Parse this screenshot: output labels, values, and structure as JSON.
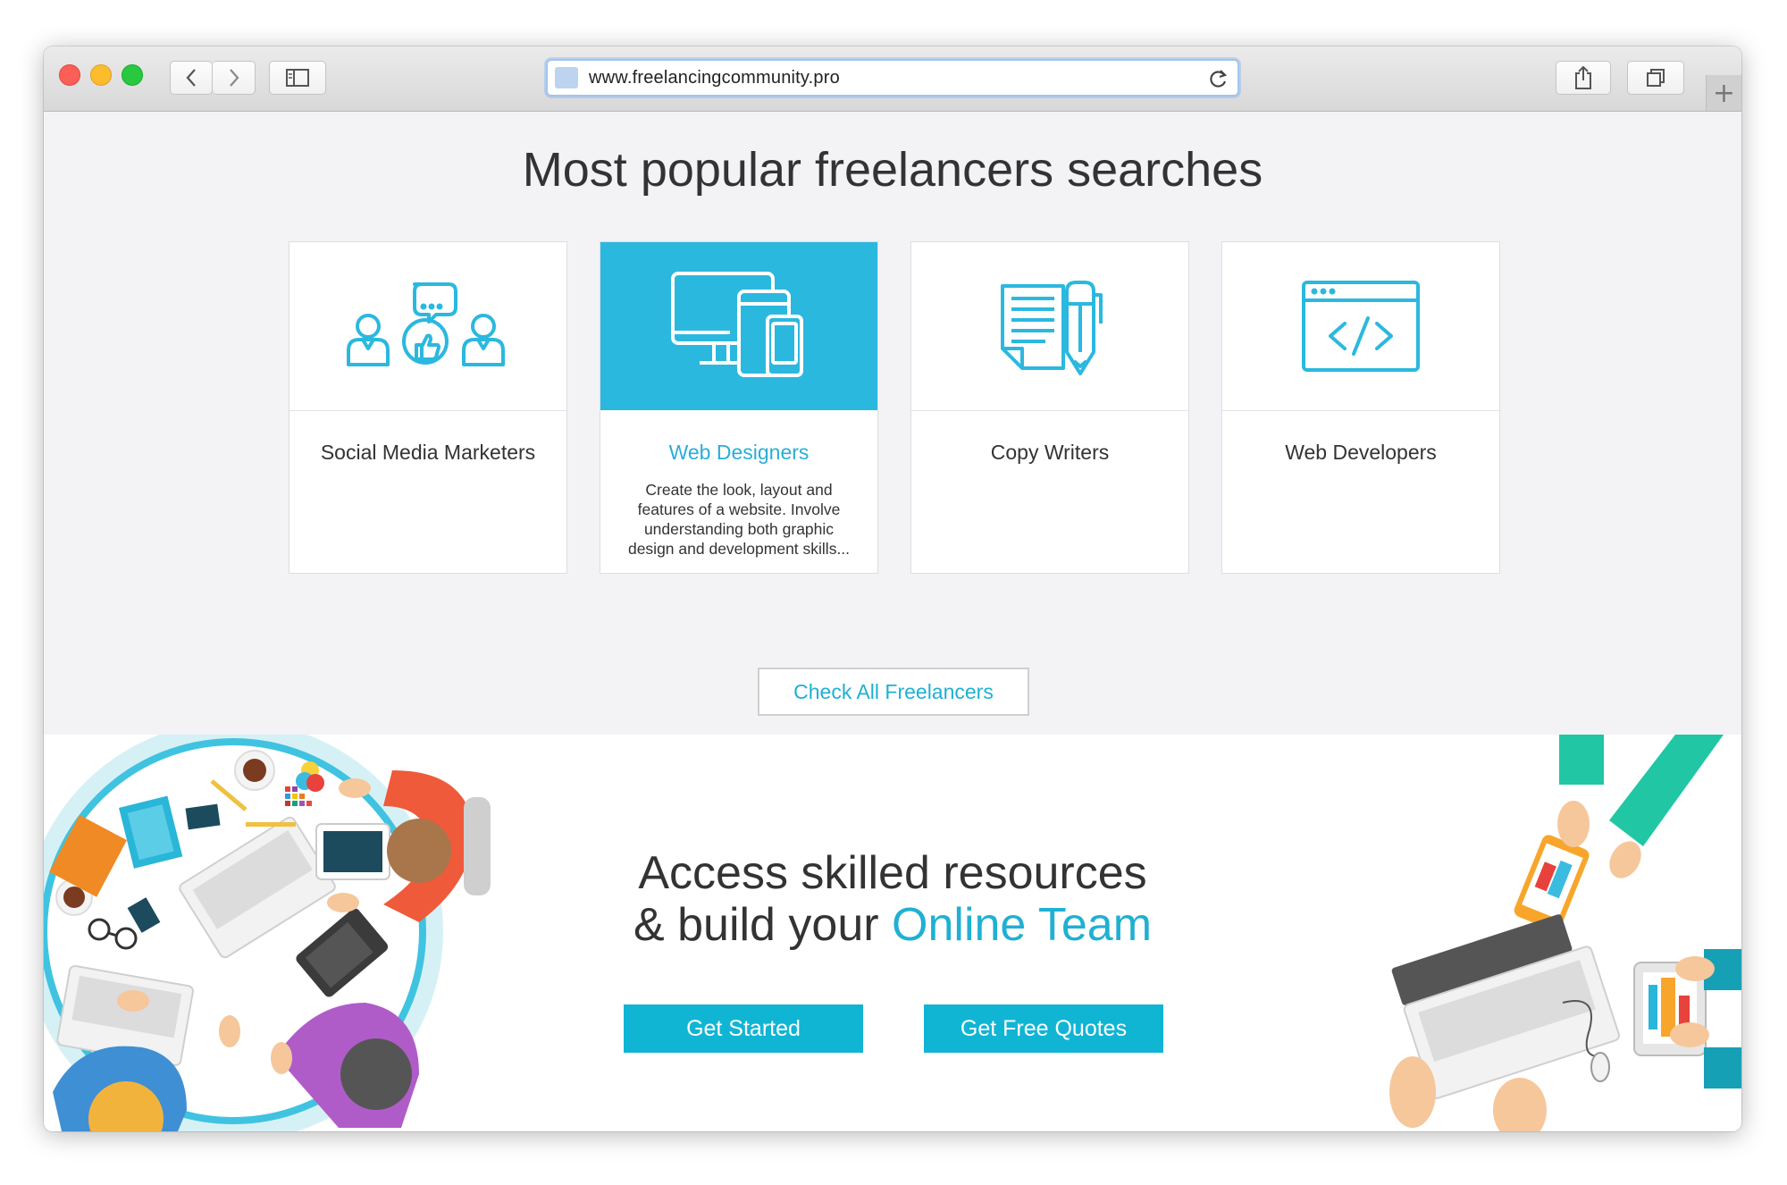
{
  "browser": {
    "url": "www.freelancingcommunity.pro",
    "new_tab_symbol": "+"
  },
  "popular": {
    "title": "Most popular freelancers searches",
    "cards": [
      {
        "label": "Social Media Marketers",
        "icon": "social-media-marketers-icon",
        "active": false,
        "description": ""
      },
      {
        "label": "Web Designers",
        "icon": "devices-icon",
        "active": true,
        "description": "Create the look, layout and features of a website. Involve understanding both graphic design and development skills..."
      },
      {
        "label": "Copy Writers",
        "icon": "document-pen-icon",
        "active": false,
        "description": ""
      },
      {
        "label": "Web Developers",
        "icon": "code-window-icon",
        "active": false,
        "description": ""
      }
    ],
    "check_all_label": "Check All Freelancers"
  },
  "team": {
    "heading_line1": "Access skilled resources",
    "heading_line2_prefix": "& build your ",
    "heading_line2_accent": "Online Team",
    "get_started_label": "Get Started",
    "get_quotes_label": "Get Free Quotes"
  },
  "colors": {
    "accent": "#2bb8df",
    "button": "#10b5d4",
    "page_bg": "#f3f3f6"
  }
}
